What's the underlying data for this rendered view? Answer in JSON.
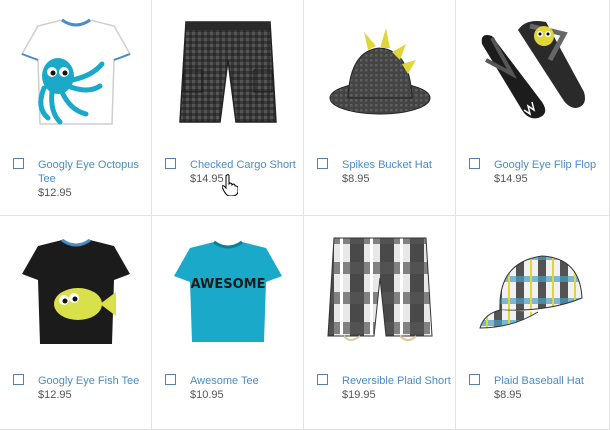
{
  "products": [
    {
      "name": "Googly Eye Octopus Tee",
      "price": "$12.95",
      "icon": "octopus-tee"
    },
    {
      "name": "Checked Cargo Short",
      "price": "$14.95",
      "icon": "cargo-short"
    },
    {
      "name": "Spikes Bucket Hat",
      "price": "$8.95",
      "icon": "bucket-hat"
    },
    {
      "name": "Googly Eye Flip Flop",
      "price": "$14.95",
      "icon": "flip-flop"
    },
    {
      "name": "Googly Eye Fish Tee",
      "price": "$12.95",
      "icon": "fish-tee"
    },
    {
      "name": "Awesome Tee",
      "price": "$10.95",
      "icon": "awesome-tee"
    },
    {
      "name": "Reversible Plaid Short",
      "price": "$19.95",
      "icon": "plaid-short"
    },
    {
      "name": "Plaid Baseball Hat",
      "price": "$8.95",
      "icon": "baseball-hat"
    }
  ],
  "awesome_tee_print": "AWESOME",
  "colors": {
    "link": "#4a8cc4",
    "price": "#555555",
    "divider": "#e2e2e2",
    "teal": "#1aa9c9",
    "black_tee": "#1b1b1b",
    "fish": "#d8e04a"
  }
}
